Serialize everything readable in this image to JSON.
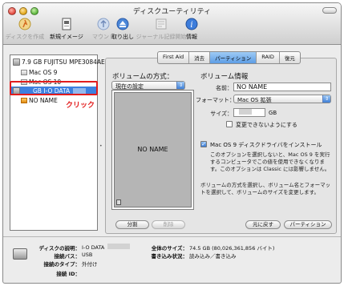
{
  "window": {
    "title": "ディスクユーティリティ"
  },
  "toolbar": [
    {
      "label": "ディスクを作成",
      "icon": "burn-icon",
      "disabled": true
    },
    {
      "label": "新規イメージ",
      "icon": "new-image-icon",
      "disabled": false
    },
    {
      "label": "マウント",
      "icon": "mount-icon",
      "disabled": true
    },
    {
      "label": "取り出し",
      "icon": "eject-icon",
      "disabled": false
    },
    {
      "label": "ジャーナル記録開始",
      "icon": "journaling-icon",
      "disabled": true
    },
    {
      "label": "情報",
      "icon": "info-icon",
      "disabled": false
    }
  ],
  "volumes": [
    {
      "label": "7.9 GB FUJITSU MPE3084AE",
      "type": "disk"
    },
    {
      "label": "Mac OS 9",
      "type": "volume"
    },
    {
      "label": "Mac OS 10",
      "type": "volume"
    },
    {
      "label": "GB I-O DATA",
      "type": "disk",
      "selected": true
    },
    {
      "label": "NO NAME",
      "type": "volume"
    }
  ],
  "annotation": {
    "click_label": "クリック",
    "color": "#e21c1c"
  },
  "tabs": [
    "First Aid",
    "消去",
    "パーティション",
    "RAID",
    "復元"
  ],
  "active_tab": 2,
  "partition": {
    "scheme_title": "ボリュームの方式：",
    "scheme_value": "現在の設定",
    "info_title": "ボリューム情報",
    "name_label": "名前：",
    "name_value": "NO NAME",
    "format_label": "フォーマット：",
    "format_value": "Mac OS 拡張",
    "size_label": "サイズ：",
    "size_unit": "GB",
    "locked_label": "変更できないようにする",
    "locked_checked": false,
    "install_driver_label": "Mac OS 9 ディスクドライバをインストール",
    "install_driver_checked": true,
    "driver_desc": "このオプションを選択しないと、Mac OS 9 を実行するコンピュータでこの値を使用できなくなります。このオプションは Classic には影響しません。",
    "scheme_desc": "ボリュームの方式を選択し、ボリューム名とフォーマットを選択して、ボリュームのサイズを変更します。",
    "volume_block_name": "NO NAME",
    "split_button": "分割",
    "delete_button": "削除",
    "revert_button": "元に戻す",
    "partition_button": "パーティション"
  },
  "footer": {
    "desc_key": "ディスクの説明：",
    "desc_value": "I-O DATA",
    "bus_key": "接続バス：",
    "bus_value": "USB",
    "type_key": "接続のタイプ：",
    "type_value": "外付け",
    "id_key": "接続 ID：",
    "id_value": "",
    "total_key": "全体のサイズ：",
    "total_value": "74.5 GB (80,026,361,856 バイト)",
    "write_key": "書き込み状況：",
    "write_value": "読み込み／書き込み"
  },
  "colors": {
    "selection": "#3d80df",
    "accent": "#5d9de5"
  }
}
